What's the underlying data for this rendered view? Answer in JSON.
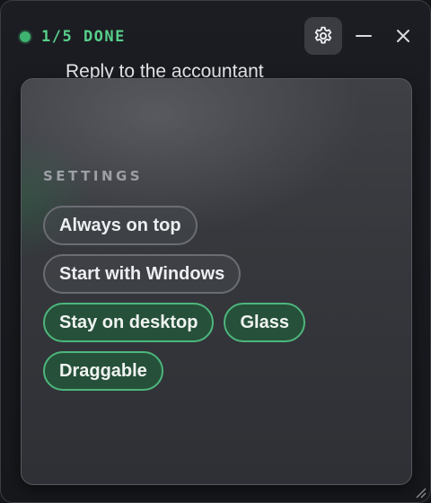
{
  "status": {
    "text": "1/5 DONE",
    "color": "#57d08a"
  },
  "toolbar": {
    "settings_icon": "gear-icon",
    "minimize_icon": "minimize-icon",
    "close_icon": "close-icon"
  },
  "task": {
    "title": "Reply to the accountant"
  },
  "settings": {
    "label": "SETTINGS",
    "options": [
      {
        "label": "Always on top",
        "enabled": false
      },
      {
        "label": "Start with Windows",
        "enabled": false
      },
      {
        "label": "Stay on desktop",
        "enabled": true
      },
      {
        "label": "Glass",
        "enabled": true
      },
      {
        "label": "Draggable",
        "enabled": true
      }
    ]
  },
  "colors": {
    "accent_green": "#4db67c",
    "toggle_on_bg": "#26503a",
    "panel_border": "#55585e"
  }
}
